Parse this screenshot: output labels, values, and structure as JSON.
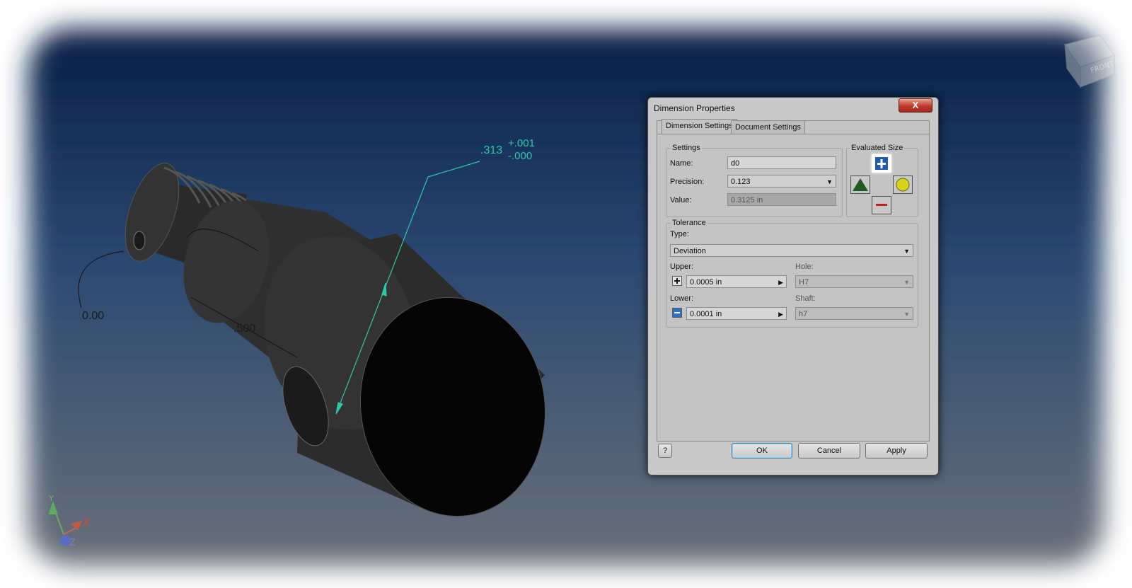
{
  "viewport": {
    "dimension_value": ".313",
    "dimension_tol_upper": "+.001",
    "dimension_tol_lower": "-.000",
    "angle_label": "0.00",
    "length_label": ".500",
    "axis_x": "X",
    "axis_y": "Y",
    "axis_z": "Z",
    "viewcube_label": "FRONT",
    "colors": {
      "dimension": "#2fc7a8",
      "background_top": "#08264f",
      "background_bottom": "#6b7280",
      "part": "#2d2d2d"
    }
  },
  "dialog": {
    "title": "Dimension Properties",
    "close_label": "X",
    "tabs": [
      {
        "label": "Dimension Settings",
        "active": true
      },
      {
        "label": "Document Settings",
        "active": false
      }
    ],
    "settings": {
      "group_label": "Settings",
      "name_label": "Name:",
      "name_value": "d0",
      "precision_label": "Precision:",
      "precision_value": "0.123",
      "value_label": "Value:",
      "value_value": "0.3125 in"
    },
    "evaluated_size": {
      "group_label": "Evaluated Size",
      "buttons": [
        {
          "icon": "plus-icon",
          "selected": true
        },
        {
          "icon": "triangle-icon",
          "selected": false
        },
        {
          "icon": "circle-icon",
          "selected": false
        },
        {
          "icon": "minus-icon",
          "selected": false
        }
      ]
    },
    "tolerance": {
      "group_label": "Tolerance",
      "type_label": "Type:",
      "type_value": "Deviation",
      "upper_label": "Upper:",
      "upper_value": "0.0005 in",
      "lower_label": "Lower:",
      "lower_value": "0.0001 in",
      "hole_label": "Hole:",
      "hole_value": "H7",
      "shaft_label": "Shaft:",
      "shaft_value": "h7"
    },
    "footer": {
      "help_icon": "help-icon",
      "ok_label": "OK",
      "cancel_label": "Cancel",
      "apply_label": "Apply"
    }
  }
}
